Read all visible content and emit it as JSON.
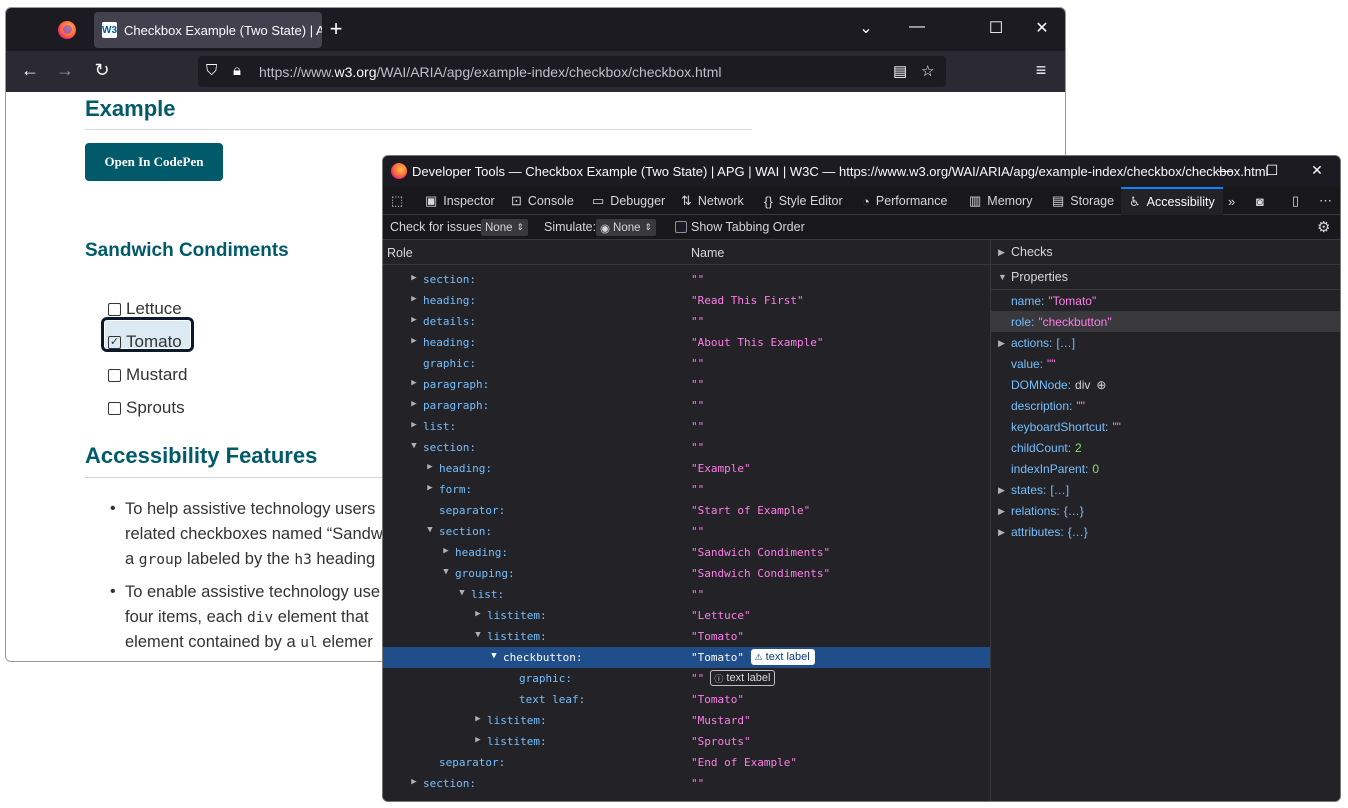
{
  "browser": {
    "tab_title": "Checkbox Example (Two State) | APG | WAI | W3C",
    "favicon_text": "W3",
    "url_prefix": "https://www.",
    "url_domain": "w3.org",
    "url_path": "/WAI/ARIA/apg/example-index/checkbox/checkbox.html"
  },
  "page": {
    "example_heading": "Example",
    "codepen_label": "Open In CodePen",
    "sandwich_heading": "Sandwich Condiments",
    "checkboxes": [
      {
        "label": "Lettuce",
        "checked": false
      },
      {
        "label": "Tomato",
        "checked": true
      },
      {
        "label": "Mustard",
        "checked": false
      },
      {
        "label": "Sprouts",
        "checked": false
      }
    ],
    "access_heading": "Accessibility Features",
    "bullet1": {
      "l1": "To help assistive technology users",
      "l2": "related checkboxes named “Sandw",
      "l3a": "a ",
      "l3code": "group",
      "l3b": " labeled by the ",
      "l3code2": "h3",
      "l3c": " heading"
    },
    "bullet2": {
      "l1": "To enable assistive technology use",
      "l2a": "four items, each ",
      "l2code": "div",
      "l2b": " element that",
      "l3a": "element contained by a ",
      "l3code": "ul",
      "l3b": " elemer"
    }
  },
  "devtools": {
    "title": "Developer Tools — Checkbox Example (Two State) | APG | WAI | W3C — https://www.w3.org/WAI/ARIA/apg/example-index/checkbox/checkbox.html",
    "tabs": [
      {
        "label": "Inspector",
        "icon": "inspector-icon"
      },
      {
        "label": "Console",
        "icon": "console-icon"
      },
      {
        "label": "Debugger",
        "icon": "debugger-icon"
      },
      {
        "label": "Network",
        "icon": "network-icon"
      },
      {
        "label": "Style Editor",
        "icon": "style-editor-icon"
      },
      {
        "label": "Performance",
        "icon": "performance-icon"
      },
      {
        "label": "Memory",
        "icon": "memory-icon"
      },
      {
        "label": "Storage",
        "icon": "storage-icon"
      },
      {
        "label": "Accessibility",
        "icon": "accessibility-icon",
        "active": true
      }
    ],
    "toolbar": {
      "check_issues_label": "Check for issues:",
      "check_issues_value": "None",
      "simulate_label": "Simulate:",
      "simulate_value": "None",
      "tabbing_label": "Show Tabbing Order"
    },
    "tree_columns": {
      "role": "Role",
      "name": "Name"
    },
    "tree_rows": [
      {
        "role": "section:",
        "name": "\"\"",
        "depth": 0,
        "twisty": "closed"
      },
      {
        "role": "heading:",
        "name": "\"Read This First\"",
        "depth": 0,
        "twisty": "closed"
      },
      {
        "role": "details:",
        "name": "\"\"",
        "depth": 0,
        "twisty": "closed"
      },
      {
        "role": "heading:",
        "name": "\"About This Example\"",
        "depth": 0,
        "twisty": "closed"
      },
      {
        "role": "graphic:",
        "name": "\"\"",
        "depth": 0,
        "twisty": "none"
      },
      {
        "role": "paragraph:",
        "name": "\"\"",
        "depth": 0,
        "twisty": "closed"
      },
      {
        "role": "paragraph:",
        "name": "\"\"",
        "depth": 0,
        "twisty": "closed"
      },
      {
        "role": "list:",
        "name": "\"\"",
        "depth": 0,
        "twisty": "closed"
      },
      {
        "role": "section:",
        "name": "\"\"",
        "depth": 0,
        "twisty": "open"
      },
      {
        "role": "heading:",
        "name": "\"Example\"",
        "depth": 1,
        "twisty": "closed"
      },
      {
        "role": "form:",
        "name": "\"\"",
        "depth": 1,
        "twisty": "closed"
      },
      {
        "role": "separator:",
        "name": "\"Start of Example\"",
        "depth": 1,
        "twisty": "none"
      },
      {
        "role": "section:",
        "name": "\"\"",
        "depth": 1,
        "twisty": "open"
      },
      {
        "role": "heading:",
        "name": "\"Sandwich Condiments\"",
        "depth": 2,
        "twisty": "closed"
      },
      {
        "role": "grouping:",
        "name": "\"Sandwich Condiments\"",
        "depth": 2,
        "twisty": "open"
      },
      {
        "role": "list:",
        "name": "\"\"",
        "depth": 3,
        "twisty": "open"
      },
      {
        "role": "listitem:",
        "name": "\"Lettuce\"",
        "depth": 4,
        "twisty": "closed"
      },
      {
        "role": "listitem:",
        "name": "\"Tomato\"",
        "depth": 4,
        "twisty": "open"
      },
      {
        "role": "checkbutton:",
        "name": "\"Tomato\"",
        "depth": 5,
        "twisty": "open",
        "selected": true,
        "badge": "text label",
        "badge_type": "warn"
      },
      {
        "role": "graphic:",
        "name": "\"\"",
        "depth": 6,
        "twisty": "none",
        "badge": "text label",
        "badge_type": "info"
      },
      {
        "role": "text leaf:",
        "name": "\"Tomato\"",
        "depth": 6,
        "twisty": "none"
      },
      {
        "role": "listitem:",
        "name": "\"Mustard\"",
        "depth": 4,
        "twisty": "closed"
      },
      {
        "role": "listitem:",
        "name": "\"Sprouts\"",
        "depth": 4,
        "twisty": "closed"
      },
      {
        "role": "separator:",
        "name": "\"End of Example\"",
        "depth": 1,
        "twisty": "none"
      },
      {
        "role": "section:",
        "name": "\"\"",
        "depth": 0,
        "twisty": "closed"
      }
    ],
    "side": {
      "checks_label": "Checks",
      "properties_label": "Properties",
      "properties": [
        {
          "key": "name:",
          "value": "\"Tomato\"",
          "type": "str"
        },
        {
          "key": "role:",
          "value": "\"checkbutton\"",
          "type": "str",
          "highlight": true
        },
        {
          "key": "actions:",
          "value": "[…]",
          "type": "obj",
          "twisty": true
        },
        {
          "key": "value:",
          "value": "\"\"",
          "type": "str"
        },
        {
          "key": "DOMNode:",
          "value": "div",
          "type": "plain",
          "node_icon": true
        },
        {
          "key": "description:",
          "value": "\"\"",
          "type": "str"
        },
        {
          "key": "keyboardShortcut:",
          "value": "\"\"",
          "type": "str"
        },
        {
          "key": "childCount:",
          "value": "2",
          "type": "num"
        },
        {
          "key": "indexInParent:",
          "value": "0",
          "type": "num"
        },
        {
          "key": "states:",
          "value": "[…]",
          "type": "obj",
          "twisty": true
        },
        {
          "key": "relations:",
          "value": "{…}",
          "type": "obj",
          "twisty": true
        },
        {
          "key": "attributes:",
          "value": "{…}",
          "type": "obj",
          "twisty": true
        }
      ]
    }
  }
}
